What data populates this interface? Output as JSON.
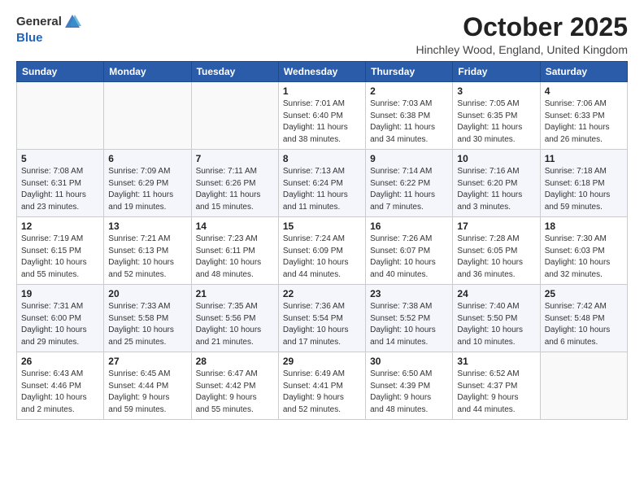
{
  "header": {
    "logo_general": "General",
    "logo_blue": "Blue",
    "month_title": "October 2025",
    "location": "Hinchley Wood, England, United Kingdom"
  },
  "weekdays": [
    "Sunday",
    "Monday",
    "Tuesday",
    "Wednesday",
    "Thursday",
    "Friday",
    "Saturday"
  ],
  "weeks": [
    [
      {
        "day": "",
        "info": ""
      },
      {
        "day": "",
        "info": ""
      },
      {
        "day": "",
        "info": ""
      },
      {
        "day": "1",
        "info": "Sunrise: 7:01 AM\nSunset: 6:40 PM\nDaylight: 11 hours\nand 38 minutes."
      },
      {
        "day": "2",
        "info": "Sunrise: 7:03 AM\nSunset: 6:38 PM\nDaylight: 11 hours\nand 34 minutes."
      },
      {
        "day": "3",
        "info": "Sunrise: 7:05 AM\nSunset: 6:35 PM\nDaylight: 11 hours\nand 30 minutes."
      },
      {
        "day": "4",
        "info": "Sunrise: 7:06 AM\nSunset: 6:33 PM\nDaylight: 11 hours\nand 26 minutes."
      }
    ],
    [
      {
        "day": "5",
        "info": "Sunrise: 7:08 AM\nSunset: 6:31 PM\nDaylight: 11 hours\nand 23 minutes."
      },
      {
        "day": "6",
        "info": "Sunrise: 7:09 AM\nSunset: 6:29 PM\nDaylight: 11 hours\nand 19 minutes."
      },
      {
        "day": "7",
        "info": "Sunrise: 7:11 AM\nSunset: 6:26 PM\nDaylight: 11 hours\nand 15 minutes."
      },
      {
        "day": "8",
        "info": "Sunrise: 7:13 AM\nSunset: 6:24 PM\nDaylight: 11 hours\nand 11 minutes."
      },
      {
        "day": "9",
        "info": "Sunrise: 7:14 AM\nSunset: 6:22 PM\nDaylight: 11 hours\nand 7 minutes."
      },
      {
        "day": "10",
        "info": "Sunrise: 7:16 AM\nSunset: 6:20 PM\nDaylight: 11 hours\nand 3 minutes."
      },
      {
        "day": "11",
        "info": "Sunrise: 7:18 AM\nSunset: 6:18 PM\nDaylight: 10 hours\nand 59 minutes."
      }
    ],
    [
      {
        "day": "12",
        "info": "Sunrise: 7:19 AM\nSunset: 6:15 PM\nDaylight: 10 hours\nand 55 minutes."
      },
      {
        "day": "13",
        "info": "Sunrise: 7:21 AM\nSunset: 6:13 PM\nDaylight: 10 hours\nand 52 minutes."
      },
      {
        "day": "14",
        "info": "Sunrise: 7:23 AM\nSunset: 6:11 PM\nDaylight: 10 hours\nand 48 minutes."
      },
      {
        "day": "15",
        "info": "Sunrise: 7:24 AM\nSunset: 6:09 PM\nDaylight: 10 hours\nand 44 minutes."
      },
      {
        "day": "16",
        "info": "Sunrise: 7:26 AM\nSunset: 6:07 PM\nDaylight: 10 hours\nand 40 minutes."
      },
      {
        "day": "17",
        "info": "Sunrise: 7:28 AM\nSunset: 6:05 PM\nDaylight: 10 hours\nand 36 minutes."
      },
      {
        "day": "18",
        "info": "Sunrise: 7:30 AM\nSunset: 6:03 PM\nDaylight: 10 hours\nand 32 minutes."
      }
    ],
    [
      {
        "day": "19",
        "info": "Sunrise: 7:31 AM\nSunset: 6:00 PM\nDaylight: 10 hours\nand 29 minutes."
      },
      {
        "day": "20",
        "info": "Sunrise: 7:33 AM\nSunset: 5:58 PM\nDaylight: 10 hours\nand 25 minutes."
      },
      {
        "day": "21",
        "info": "Sunrise: 7:35 AM\nSunset: 5:56 PM\nDaylight: 10 hours\nand 21 minutes."
      },
      {
        "day": "22",
        "info": "Sunrise: 7:36 AM\nSunset: 5:54 PM\nDaylight: 10 hours\nand 17 minutes."
      },
      {
        "day": "23",
        "info": "Sunrise: 7:38 AM\nSunset: 5:52 PM\nDaylight: 10 hours\nand 14 minutes."
      },
      {
        "day": "24",
        "info": "Sunrise: 7:40 AM\nSunset: 5:50 PM\nDaylight: 10 hours\nand 10 minutes."
      },
      {
        "day": "25",
        "info": "Sunrise: 7:42 AM\nSunset: 5:48 PM\nDaylight: 10 hours\nand 6 minutes."
      }
    ],
    [
      {
        "day": "26",
        "info": "Sunrise: 6:43 AM\nSunset: 4:46 PM\nDaylight: 10 hours\nand 2 minutes."
      },
      {
        "day": "27",
        "info": "Sunrise: 6:45 AM\nSunset: 4:44 PM\nDaylight: 9 hours\nand 59 minutes."
      },
      {
        "day": "28",
        "info": "Sunrise: 6:47 AM\nSunset: 4:42 PM\nDaylight: 9 hours\nand 55 minutes."
      },
      {
        "day": "29",
        "info": "Sunrise: 6:49 AM\nSunset: 4:41 PM\nDaylight: 9 hours\nand 52 minutes."
      },
      {
        "day": "30",
        "info": "Sunrise: 6:50 AM\nSunset: 4:39 PM\nDaylight: 9 hours\nand 48 minutes."
      },
      {
        "day": "31",
        "info": "Sunrise: 6:52 AM\nSunset: 4:37 PM\nDaylight: 9 hours\nand 44 minutes."
      },
      {
        "day": "",
        "info": ""
      }
    ]
  ]
}
